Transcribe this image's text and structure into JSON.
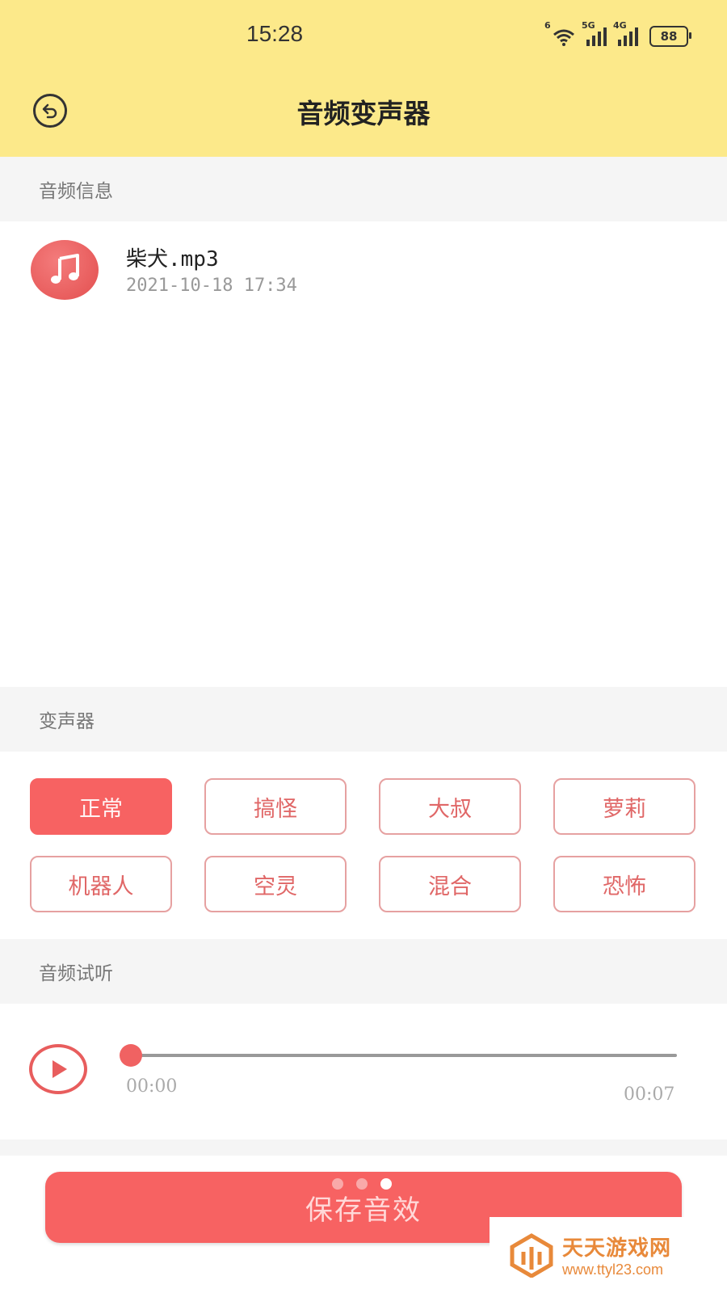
{
  "status_bar": {
    "time": "15:28",
    "wifi_label": "6",
    "signal1_label": "5G",
    "signal2_label": "4G",
    "battery": "88"
  },
  "header": {
    "back_icon": "back-arrow-icon",
    "title": "音频变声器"
  },
  "sections": {
    "audio_info": "音频信息",
    "voice_changer": "变声器",
    "audio_preview": "音频试听"
  },
  "file": {
    "icon": "music-note-icon",
    "name": "柴犬.mp3",
    "date": "2021-10-18 17:34"
  },
  "effects": [
    {
      "label": "正常",
      "active": true
    },
    {
      "label": "搞怪",
      "active": false
    },
    {
      "label": "大叔",
      "active": false
    },
    {
      "label": "萝莉",
      "active": false
    },
    {
      "label": "机器人",
      "active": false
    },
    {
      "label": "空灵",
      "active": false
    },
    {
      "label": "混合",
      "active": false
    },
    {
      "label": "恐怖",
      "active": false
    }
  ],
  "player": {
    "play_icon": "play-icon",
    "current_time": "00:00",
    "total_time": "00:07",
    "progress": 0
  },
  "save_button": {
    "label": "保存音效"
  },
  "pager": {
    "count": 3,
    "active_index": 2
  },
  "watermark": {
    "title": "天天游戏网",
    "url": "www.ttyl23.com"
  },
  "colors": {
    "header_bg": "#fce98a",
    "accent": "#f76262",
    "section_bg": "#f5f5f5"
  }
}
